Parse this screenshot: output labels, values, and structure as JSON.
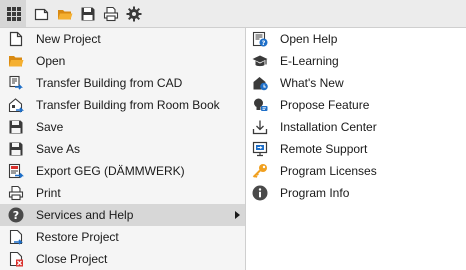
{
  "toolbar": {
    "icons": [
      "app-grid-icon",
      "new-document-icon",
      "open-folder-icon",
      "save-disk-icon",
      "print-icon",
      "settings-gear-icon"
    ]
  },
  "menu": {
    "items": [
      {
        "label": "New Project",
        "icon": "new-document-icon"
      },
      {
        "label": "Open",
        "icon": "open-folder-icon"
      },
      {
        "label": "Transfer Building from CAD",
        "icon": "cad-transfer-icon"
      },
      {
        "label": "Transfer Building from Room Book",
        "icon": "room-book-transfer-icon"
      },
      {
        "label": "Save",
        "icon": "save-disk-icon"
      },
      {
        "label": "Save As",
        "icon": "save-as-icon"
      },
      {
        "label": "Export GEG (DÄMMWERK)",
        "icon": "export-icon"
      },
      {
        "label": "Print",
        "icon": "print-icon"
      },
      {
        "label": "Services and Help",
        "icon": "help-icon",
        "active": true,
        "submenu": true
      },
      {
        "label": "Restore Project",
        "icon": "restore-icon"
      },
      {
        "label": "Close Project",
        "icon": "close-project-icon"
      }
    ]
  },
  "submenu": {
    "items": [
      {
        "label": "Open Help",
        "icon": "open-help-icon"
      },
      {
        "label": "E-Learning",
        "icon": "graduation-cap-icon"
      },
      {
        "label": "What's New",
        "icon": "whats-new-icon"
      },
      {
        "label": "Propose Feature",
        "icon": "lightbulb-icon"
      },
      {
        "label": "Installation Center",
        "icon": "download-icon"
      },
      {
        "label": "Remote Support",
        "icon": "remote-support-icon"
      },
      {
        "label": "Program Licenses",
        "icon": "key-icon"
      },
      {
        "label": "Program Info",
        "icon": "info-icon"
      }
    ]
  },
  "colors": {
    "toolbar_bg": "#ececec",
    "menu_bg": "#f5f5f5",
    "active_bg": "#d7d7d7",
    "folder": "#f0a020",
    "blue_accent": "#1e6fc8",
    "red_accent": "#d9302c"
  }
}
